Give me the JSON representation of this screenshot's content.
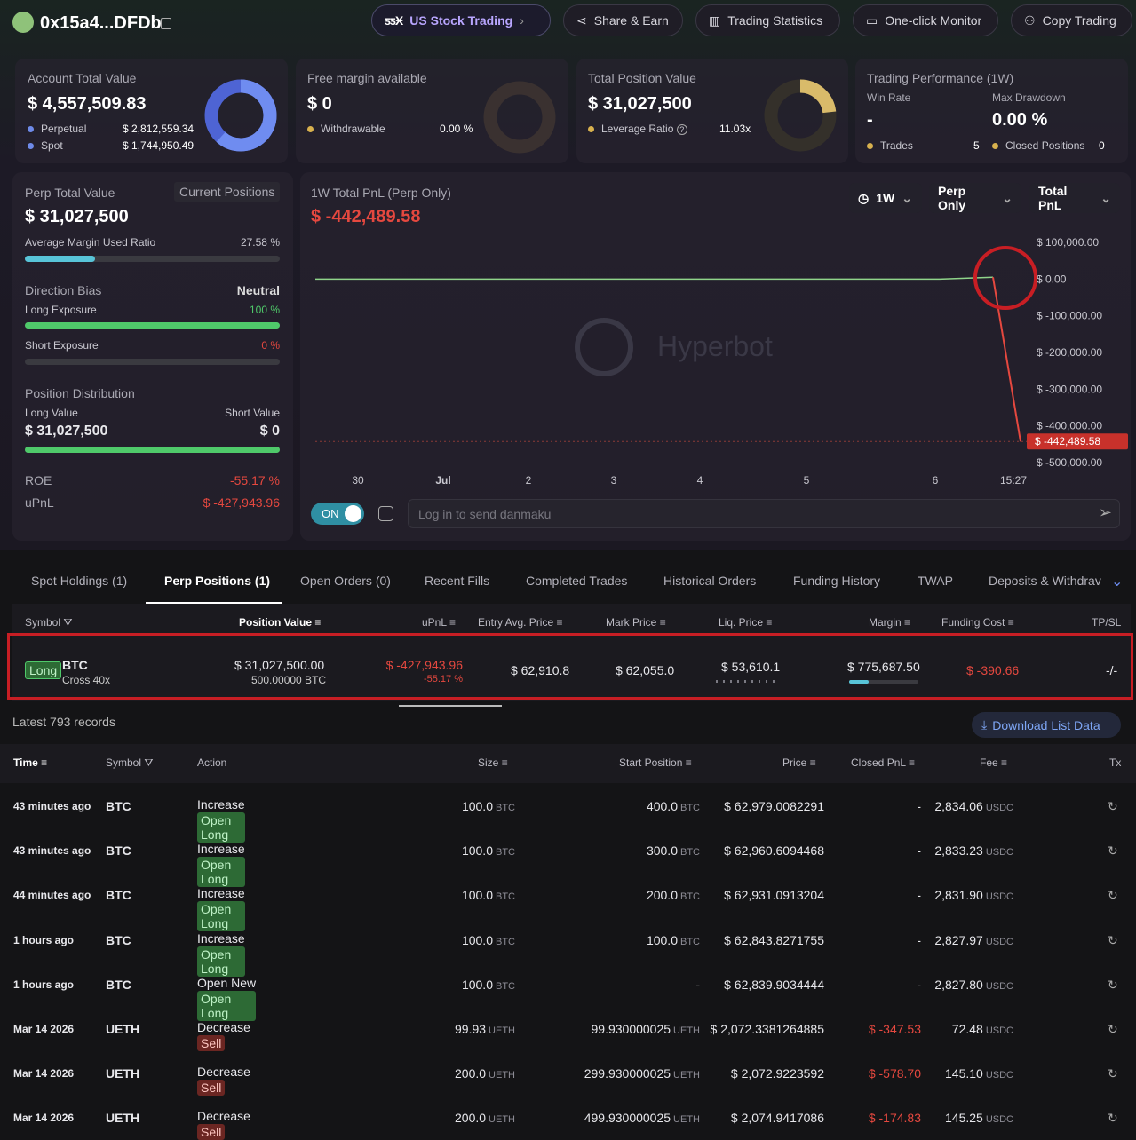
{
  "header": {
    "address": "0x15a4...DFDb",
    "us_stock_label": "US Stock Trading",
    "share": "Share & Earn",
    "stats": "Trading Statistics",
    "monitor": "One-click Monitor",
    "copy": "Copy Trading"
  },
  "account": {
    "title": "Account Total Value",
    "value": "$ 4,557,509.83",
    "perp_label": "Perpetual",
    "perp_value": "$ 2,812,559.34",
    "spot_label": "Spot",
    "spot_value": "$ 1,744,950.49"
  },
  "margin": {
    "title": "Free margin available",
    "value": "$ 0",
    "withdraw_label": "Withdrawable",
    "withdraw_value": "0.00 %"
  },
  "position": {
    "title": "Total Position Value",
    "value": "$ 31,027,500",
    "lev_label": "Leverage Ratio",
    "lev_value": "11.03x"
  },
  "performance": {
    "title": "Trading Performance (1W)",
    "win_label": "Win Rate",
    "win_value": "-",
    "dd_label": "Max Drawdown",
    "dd_value": "0.00 %",
    "trades_label": "Trades",
    "trades_value": "5",
    "closed_label": "Closed Positions",
    "closed_value": "0"
  },
  "perp": {
    "title": "Perp Total Value",
    "current_btn": "Current Positions",
    "value": "$ 31,027,500",
    "margin_label": "Average Margin Used Ratio",
    "margin_value": "27.58 %",
    "margin_pct": 27.58,
    "bias_label": "Direction Bias",
    "bias_value": "Neutral",
    "long_label": "Long Exposure",
    "long_value": "100 %",
    "long_pct": 100,
    "short_label": "Short Exposure",
    "short_value": "0 %",
    "short_pct": 0,
    "dist_label": "Position Distribution",
    "long_val_label": "Long Value",
    "long_val": "$ 31,027,500",
    "short_val_label": "Short Value",
    "short_val": "$ 0",
    "roe_label": "ROE",
    "roe": "-55.17 %",
    "upnl_label": "uPnL",
    "upnl": "$ -427,943.96"
  },
  "pnl": {
    "title": "1W Total PnL (Perp Only)",
    "value": "$ -442,489.58",
    "period": "1W",
    "scope": "Perp Only",
    "metric": "Total PnL",
    "watermark": "Hyperbot",
    "toggle": "ON",
    "danmaku_placeholder": "Log in to send danmaku"
  },
  "chart_data": {
    "type": "line",
    "x": [
      "30",
      "Jul",
      "2",
      "3",
      "4",
      "5",
      "6",
      "15:27"
    ],
    "y_ticks": [
      "$ 100,000.00",
      "$ 0.00",
      "$ -100,000.00",
      "$ -200,000.00",
      "$ -300,000.00",
      "$ -400,000.00",
      "$ -500,000.00"
    ],
    "ylim": [
      -500000,
      100000
    ],
    "last_label": "$ -442,489.58",
    "series": [
      {
        "values": [
          0,
          0,
          0,
          0,
          0,
          0,
          0,
          5000,
          -442489.58
        ]
      }
    ]
  },
  "tabs": [
    "Spot Holdings (1)",
    "Perp Positions (1)",
    "Open Orders (0)",
    "Recent Fills",
    "Completed Trades",
    "Historical Orders",
    "Funding History",
    "TWAP",
    "Deposits & Withdrav"
  ],
  "pos_headers": {
    "symbol": "Symbol",
    "value": "Position Value",
    "upnl": "uPnL",
    "entry": "Entry Avg. Price",
    "mark": "Mark Price",
    "liq": "Liq. Price",
    "margin": "Margin",
    "funding": "Funding Cost",
    "tpsl": "TP/SL"
  },
  "pos": {
    "side": "Long",
    "symbol": "BTC",
    "mode": "Cross 40x",
    "value": "$ 31,027,500.00",
    "size": "500.00000 BTC",
    "upnl": "$ -427,943.96",
    "upnl_pct": "-55.17 %",
    "entry": "$ 62,910.8",
    "mark": "$ 62,055.0",
    "liq": "$ 53,610.1",
    "margin": "$ 775,687.50",
    "funding": "$ -390.66",
    "tpsl": "-/-"
  },
  "records": {
    "label": "Latest 793 records",
    "download": "Download List Data"
  },
  "rec_headers": {
    "time": "Time",
    "symbol": "Symbol",
    "action": "Action",
    "size": "Size",
    "start": "Start Position",
    "price": "Price",
    "pnl": "Closed PnL",
    "fee": "Fee",
    "tx": "Tx"
  },
  "rows": [
    {
      "time": "43 minutes ago",
      "symbol": "BTC",
      "tag": "Open Long",
      "act": "Increase",
      "size": "100.0",
      "unit": "BTC",
      "start": "400.0",
      "price": "$ 62,979.0082291",
      "pnl": "-",
      "fee": "2,834.06"
    },
    {
      "time": "43 minutes ago",
      "symbol": "BTC",
      "tag": "Open Long",
      "act": "Increase",
      "size": "100.0",
      "unit": "BTC",
      "start": "300.0",
      "price": "$ 62,960.6094468",
      "pnl": "-",
      "fee": "2,833.23"
    },
    {
      "time": "44 minutes ago",
      "symbol": "BTC",
      "tag": "Open Long",
      "act": "Increase",
      "size": "100.0",
      "unit": "BTC",
      "start": "200.0",
      "price": "$ 62,931.0913204",
      "pnl": "-",
      "fee": "2,831.90"
    },
    {
      "time": "1 hours ago",
      "symbol": "BTC",
      "tag": "Open Long",
      "act": "Increase",
      "size": "100.0",
      "unit": "BTC",
      "start": "100.0",
      "price": "$ 62,843.8271755",
      "pnl": "-",
      "fee": "2,827.97"
    },
    {
      "time": "1 hours ago",
      "symbol": "BTC",
      "tag": "Open Long",
      "act": "Open New",
      "size": "100.0",
      "unit": "BTC",
      "start": "-",
      "price": "$ 62,839.9034444",
      "pnl": "-",
      "fee": "2,827.80"
    },
    {
      "time": "Mar 14 2026",
      "symbol": "UETH",
      "tag": "Sell",
      "act": "Decrease",
      "size": "99.93",
      "unit": "UETH",
      "start": "99.930000025",
      "price": "$ 2,072.3381264885",
      "pnl": "$ -347.53",
      "fee": "72.48"
    },
    {
      "time": "Mar 14 2026",
      "symbol": "UETH",
      "tag": "Sell",
      "act": "Decrease",
      "size": "200.0",
      "unit": "UETH",
      "start": "299.930000025",
      "price": "$ 2,072.9223592",
      "pnl": "$ -578.70",
      "fee": "145.10"
    },
    {
      "time": "Mar 14 2026",
      "symbol": "UETH",
      "tag": "Sell",
      "act": "Decrease",
      "size": "200.0",
      "unit": "UETH",
      "start": "499.930000025",
      "price": "$ 2,074.9417086",
      "pnl": "$ -174.83",
      "fee": "145.25"
    }
  ],
  "fee_unit": "USDC"
}
